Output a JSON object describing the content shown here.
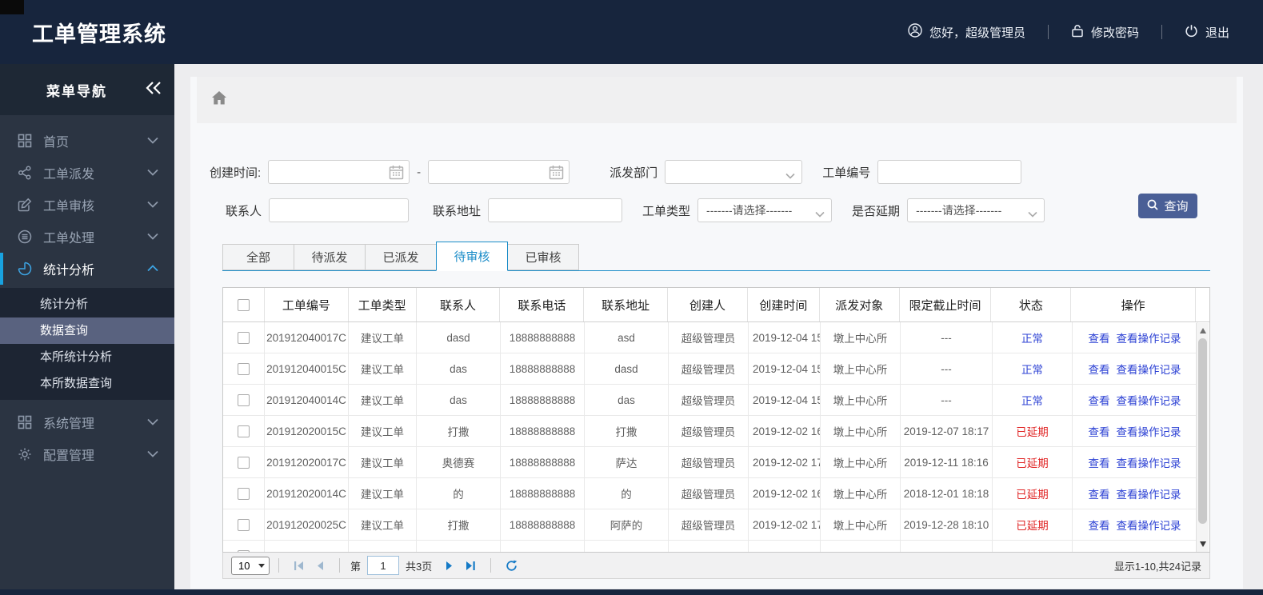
{
  "header": {
    "title": "工单管理系统",
    "greeting": "您好，超级管理员",
    "change_password": "修改密码",
    "logout": "退出"
  },
  "sidebar": {
    "title": "菜单导航",
    "items": [
      {
        "label": "首页",
        "icon": "grid-icon"
      },
      {
        "label": "工单派发",
        "icon": "share-icon"
      },
      {
        "label": "工单审核",
        "icon": "edit-icon"
      },
      {
        "label": "工单处理",
        "icon": "database-icon"
      },
      {
        "label": "统计分析",
        "icon": "pie-icon",
        "active": true
      },
      {
        "label": "系统管理",
        "icon": "grid-icon"
      },
      {
        "label": "配置管理",
        "icon": "gear-icon"
      }
    ],
    "submenu": {
      "items": [
        {
          "label": "统计分析",
          "selected": false
        },
        {
          "label": "数据查询",
          "selected": true
        },
        {
          "label": "本所统计分析",
          "selected": false
        },
        {
          "label": "本所数据查询",
          "selected": false
        }
      ]
    }
  },
  "filters": {
    "create_time_label": "创建时间:",
    "range_separator": "-",
    "dispatch_dept_label": "派发部门",
    "order_no_label": "工单编号",
    "contact_label": "联系人",
    "address_label": "联系地址",
    "order_type_label": "工单类型",
    "delay_label": "是否延期",
    "select_placeholder": "-------请选择-------",
    "query_button": "查询"
  },
  "tabs": [
    {
      "label": "全部",
      "active": false
    },
    {
      "label": "待派发",
      "active": false
    },
    {
      "label": "已派发",
      "active": false
    },
    {
      "label": "待审核",
      "active": true
    },
    {
      "label": "已审核",
      "active": false
    }
  ],
  "table": {
    "headers": [
      "工单编号",
      "工单类型",
      "联系人",
      "联系电话",
      "联系地址",
      "创建人",
      "创建时间",
      "派发对象",
      "限定截止时间",
      "状态",
      "操作"
    ],
    "actions": [
      "查看",
      "查看操作记录"
    ],
    "rows": [
      {
        "order_no": "201912040017C",
        "type": "建议工单",
        "contact": "dasd",
        "phone": "18888888888",
        "address": "asd",
        "creator": "超级管理员",
        "created": "2019-12-04 15",
        "target": "墩上中心所",
        "deadline": "---",
        "status": "正常",
        "status_type": "normal"
      },
      {
        "order_no": "201912040015C",
        "type": "建议工单",
        "contact": "das",
        "phone": "18888888888",
        "address": "dasd",
        "creator": "超级管理员",
        "created": "2019-12-04 15",
        "target": "墩上中心所",
        "deadline": "---",
        "status": "正常",
        "status_type": "normal"
      },
      {
        "order_no": "201912040014C",
        "type": "建议工单",
        "contact": "das",
        "phone": "18888888888",
        "address": "das",
        "creator": "超级管理员",
        "created": "2019-12-04 15",
        "target": "墩上中心所",
        "deadline": "---",
        "status": "正常",
        "status_type": "normal"
      },
      {
        "order_no": "201912020015C",
        "type": "建议工单",
        "contact": "打撒",
        "phone": "18888888888",
        "address": "打撒",
        "creator": "超级管理员",
        "created": "2019-12-02 16",
        "target": "墩上中心所",
        "deadline": "2019-12-07 18:17",
        "status": "已延期",
        "status_type": "delayed"
      },
      {
        "order_no": "201912020017C",
        "type": "建议工单",
        "contact": "奥德赛",
        "phone": "18888888888",
        "address": "萨达",
        "creator": "超级管理员",
        "created": "2019-12-02 17",
        "target": "墩上中心所",
        "deadline": "2019-12-11 18:16",
        "status": "已延期",
        "status_type": "delayed"
      },
      {
        "order_no": "201912020014C",
        "type": "建议工单",
        "contact": "的",
        "phone": "18888888888",
        "address": "的",
        "creator": "超级管理员",
        "created": "2019-12-02 16",
        "target": "墩上中心所",
        "deadline": "2018-12-01 18:18",
        "status": "已延期",
        "status_type": "delayed"
      },
      {
        "order_no": "201912020025C",
        "type": "建议工单",
        "contact": "打撒",
        "phone": "18888888888",
        "address": "阿萨的",
        "creator": "超级管理员",
        "created": "2019-12-02 17",
        "target": "墩上中心所",
        "deadline": "2019-12-28 18:10",
        "status": "已延期",
        "status_type": "delayed"
      }
    ]
  },
  "pagination": {
    "page_size": "10",
    "page_prefix": "第",
    "current_page": "1",
    "total_pages": "共3页",
    "summary": "显示1-10,共24记录"
  },
  "colors": {
    "header_navy": "#17253d",
    "sidebar_slate": "#2b3442",
    "accent_blue": "#1a8cc8",
    "menu_accent_blue": "#18a2e0",
    "link_blue": "#2c41d4",
    "danger_red": "#e02424",
    "button_indigo": "#4a5f96"
  }
}
